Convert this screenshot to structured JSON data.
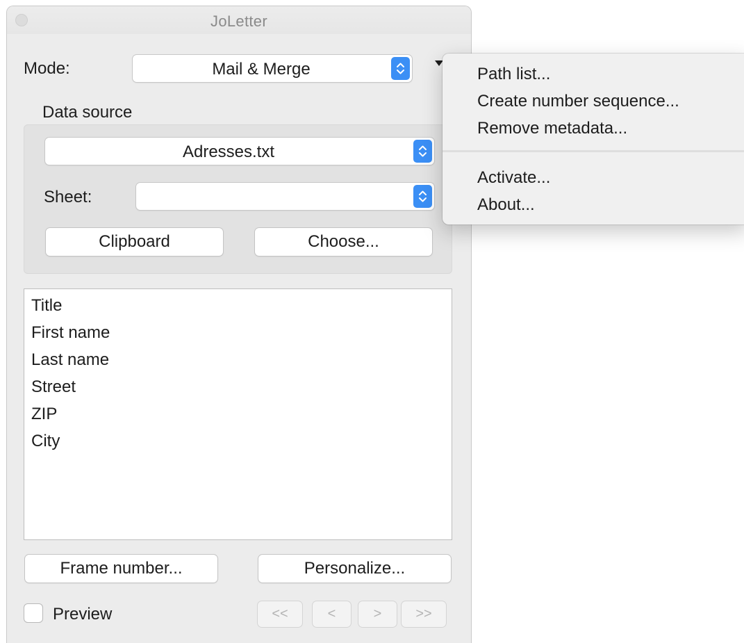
{
  "window": {
    "title": "JoLetter"
  },
  "mode": {
    "label": "Mode:",
    "value": "Mail & Merge"
  },
  "data_source": {
    "heading": "Data source",
    "file_value": "Adresses.txt",
    "sheet_label": "Sheet:",
    "sheet_value": "",
    "clipboard_label": "Clipboard",
    "choose_label": "Choose..."
  },
  "fields": [
    "Title",
    "First name",
    "Last name",
    "Street",
    "ZIP",
    "City"
  ],
  "actions": {
    "frame_number_label": "Frame number...",
    "personalize_label": "Personalize..."
  },
  "preview": {
    "label": "Preview",
    "checked": false
  },
  "nav": {
    "first": "<<",
    "prev": "<",
    "next": ">",
    "last": ">>"
  },
  "menu": {
    "items": [
      "Path list...",
      "Create number sequence...",
      "Remove metadata...",
      "Activate...",
      "About..."
    ]
  },
  "colors": {
    "accent": "#3b8ff5",
    "window_bg": "#ececec"
  }
}
